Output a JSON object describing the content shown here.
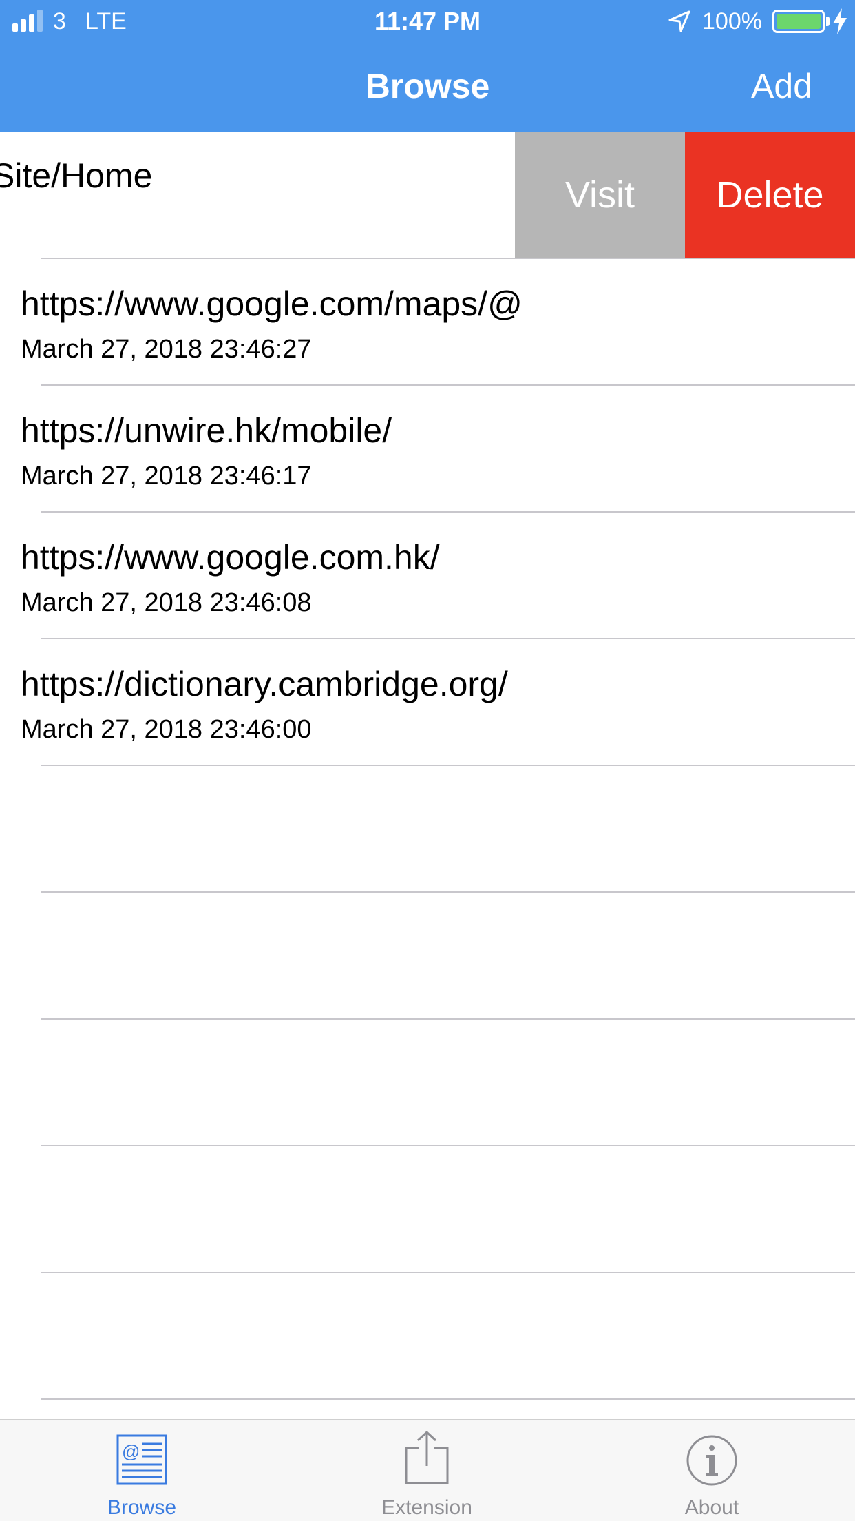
{
  "status_bar": {
    "carrier": "3",
    "network": "LTE",
    "time": "11:47 PM",
    "battery": "100%",
    "battery_level": 1.0,
    "icons": [
      "signal-icon",
      "location-arrow-icon",
      "battery-icon",
      "charging-bolt-icon"
    ]
  },
  "nav": {
    "title": "Browse",
    "add_label": "Add"
  },
  "swiped_row": {
    "url": "Site/Home",
    "visit_label": "Visit",
    "delete_label": "Delete"
  },
  "history": [
    {
      "url": "https://www.google.com/maps/@",
      "date": "March 27, 2018 23:46:27"
    },
    {
      "url": "https://unwire.hk/mobile/",
      "date": "March 27, 2018 23:46:17"
    },
    {
      "url": "https://www.google.com.hk/",
      "date": "March 27, 2018 23:46:08"
    },
    {
      "url": "https://dictionary.cambridge.org/",
      "date": "March 27, 2018 23:46:00"
    }
  ],
  "tabs": [
    {
      "label": "Browse",
      "icon": "browse-icon",
      "selected": true
    },
    {
      "label": "Extension",
      "icon": "share-icon",
      "selected": false
    },
    {
      "label": "About",
      "icon": "info-icon",
      "selected": false
    }
  ],
  "colors": {
    "nav_bar": "#4a96ec",
    "visit_action": "#b6b6b6",
    "delete_action": "#ea3323",
    "tab_selected": "#3a7be0",
    "tab_unselected": "#8e8e93"
  }
}
